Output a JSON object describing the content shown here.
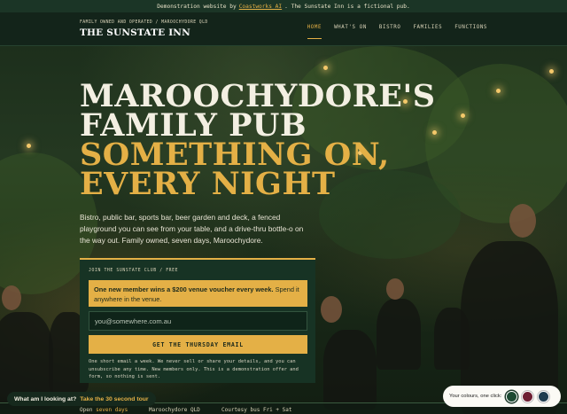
{
  "banner": {
    "prefix": "Demonstration website by",
    "link": "Coastworks AI",
    "suffix": ". The Sunstate Inn is a fictional pub."
  },
  "header": {
    "tagline": "FAMILY OWNED AND OPERATED / MAROOCHYDORE QLD",
    "brand": "THE SUNSTATE INN",
    "menu": [
      "HOME",
      "WHAT'S ON",
      "BISTRO",
      "FAMILIES",
      "FUNCTIONS"
    ]
  },
  "hero": {
    "line1": "MAROOCHYDORE'S",
    "line2": "FAMILY PUB",
    "line3": "SOMETHING ON,",
    "line4": "EVERY NIGHT",
    "intro": "Bistro, public bar, sports bar, beer garden and deck, a fenced playground you can see from your table, and a drive-thru bottle-o on the way out. Family owned, seven days, Maroochydore."
  },
  "signup": {
    "label": "JOIN THE SUNSTATE CLUB / FREE",
    "offer_bold": "One new member wins a $200 venue voucher every week.",
    "offer_rest": "Spend it anywhere in the venue.",
    "email_placeholder": "you@somewhere.com.au",
    "button": "GET THE THURSDAY EMAIL",
    "fine_print": "One short email a week. We never sell or share your details, and you can unsubscribe any time. New members only. This is a demonstration offer and form, so nothing is sent."
  },
  "footer_strip": {
    "open_label": "Open",
    "open_value": "seven days",
    "location": "Maroochydore QLD",
    "bus": "Courtesy bus Fri + Sat"
  },
  "tour": {
    "question": "What am I looking at?",
    "link": "Take the 30 second tour"
  },
  "colours": {
    "label": "Your colours, one click:",
    "swatches": [
      "#1d4a32",
      "#6e1f33",
      "#1f3c4f"
    ],
    "selected": "#1d4a32"
  },
  "accent": "#e4b046"
}
